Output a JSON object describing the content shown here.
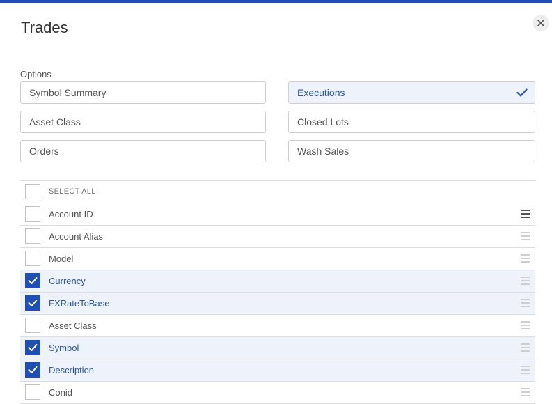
{
  "dialog": {
    "title": "Trades"
  },
  "colors": {
    "accent": "#1f4fb5",
    "selected_bg": "#eef2fa"
  },
  "options": {
    "label": "Options",
    "items": [
      {
        "label": "Symbol Summary",
        "selected": false
      },
      {
        "label": "Executions",
        "selected": true
      },
      {
        "label": "Asset Class",
        "selected": false
      },
      {
        "label": "Closed Lots",
        "selected": false
      },
      {
        "label": "Orders",
        "selected": false
      },
      {
        "label": "Wash Sales",
        "selected": false
      }
    ]
  },
  "fields": {
    "select_all_label": "SELECT ALL",
    "items": [
      {
        "label": "Account ID",
        "checked": false
      },
      {
        "label": "Account Alias",
        "checked": false
      },
      {
        "label": "Model",
        "checked": false
      },
      {
        "label": "Currency",
        "checked": true
      },
      {
        "label": "FXRateToBase",
        "checked": true
      },
      {
        "label": "Asset Class",
        "checked": false
      },
      {
        "label": "Symbol",
        "checked": true
      },
      {
        "label": "Description",
        "checked": true
      },
      {
        "label": "Conid",
        "checked": false
      }
    ]
  }
}
